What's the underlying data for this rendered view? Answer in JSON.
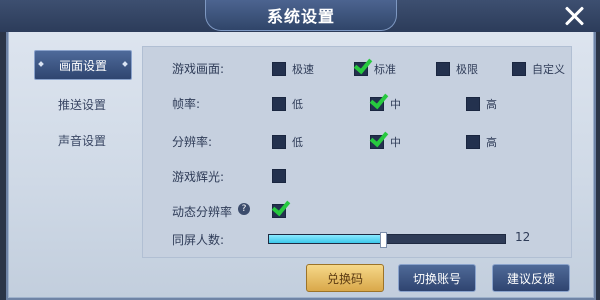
{
  "window": {
    "title": "系统设置",
    "close_icon": "close-icon"
  },
  "tabs": [
    {
      "label": "画面设置",
      "active": true
    },
    {
      "label": "推送设置",
      "active": false
    },
    {
      "label": "声音设置",
      "active": false
    }
  ],
  "settings": {
    "graphics": {
      "label": "游戏画面:",
      "options": [
        {
          "label": "极速",
          "checked": false
        },
        {
          "label": "标准",
          "checked": true
        },
        {
          "label": "极限",
          "checked": false
        },
        {
          "label": "自定义",
          "checked": false
        }
      ]
    },
    "framerate": {
      "label": "帧率:",
      "options": [
        {
          "label": "低",
          "checked": false
        },
        {
          "label": "中",
          "checked": true
        },
        {
          "label": "高",
          "checked": false
        }
      ]
    },
    "resolution": {
      "label": "分辨率:",
      "options": [
        {
          "label": "低",
          "checked": false
        },
        {
          "label": "中",
          "checked": true
        },
        {
          "label": "高",
          "checked": false
        }
      ]
    },
    "glow": {
      "label": "游戏辉光:",
      "checked": false
    },
    "dynamic_resolution": {
      "label": "动态分辨率",
      "help": "?",
      "checked": true
    },
    "same_screen": {
      "label": "同屏人数:",
      "value": "12",
      "fill_fraction": 0.48
    }
  },
  "buttons": {
    "redeem": "兑换码",
    "switch_account": "切换账号",
    "feedback": "建议反馈"
  },
  "colors": {
    "check": "#27c93f",
    "slider_fill": "#3cc8ea",
    "gold_button": "#d9a84a"
  }
}
